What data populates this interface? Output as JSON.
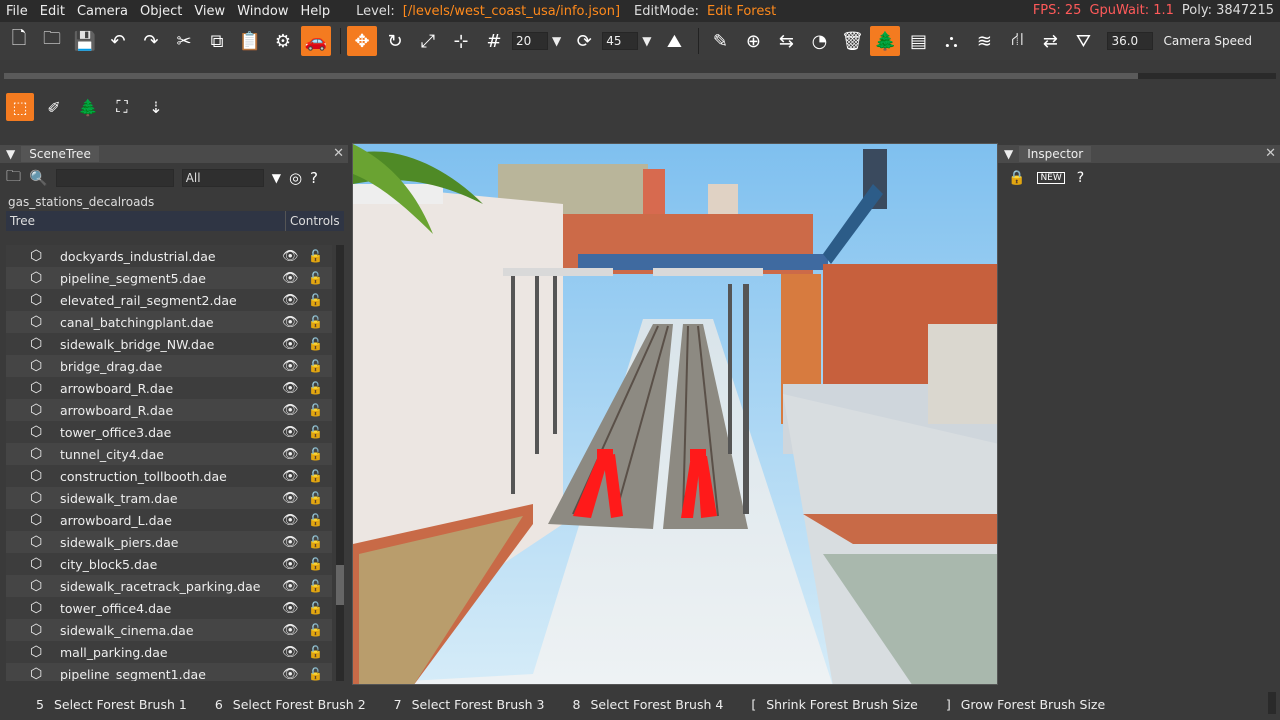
{
  "menu": {
    "items": [
      "File",
      "Edit",
      "Camera",
      "Object",
      "View",
      "Window",
      "Help"
    ],
    "level_label": "Level:",
    "level_value": "[/levels/west_coast_usa/info.json]",
    "editmode_label": "EditMode:",
    "editmode_value": "Edit Forest",
    "fps": "FPS: 25",
    "gpuwait": "GpuWait: 1.1",
    "poly": "Poly: 3847215"
  },
  "toolbar": {
    "snap_value": "20",
    "angle_value": "45",
    "camera_speed_value": "36.0",
    "camera_speed_label": "Camera Speed"
  },
  "scene_tree": {
    "title": "SceneTree",
    "filter_value": "All",
    "path": "gas_stations_decalroads",
    "col_tree": "Tree",
    "col_controls": "Controls",
    "rows": [
      "dockyards_industrial.dae",
      "pipeline_segment5.dae",
      "elevated_rail_segment2.dae",
      "canal_batchingplant.dae",
      "sidewalk_bridge_NW.dae",
      "bridge_drag.dae",
      "arrowboard_R.dae",
      "arrowboard_R.dae",
      "tower_office3.dae",
      "tunnel_city4.dae",
      "construction_tollbooth.dae",
      "sidewalk_tram.dae",
      "arrowboard_L.dae",
      "sidewalk_piers.dae",
      "city_block5.dae",
      "sidewalk_racetrack_parking.dae",
      "tower_office4.dae",
      "sidewalk_cinema.dae",
      "mall_parking.dae",
      "pipeline_segment1.dae"
    ]
  },
  "inspector": {
    "title": "Inspector",
    "new_badge": "NEW"
  },
  "status": {
    "hints": [
      {
        "key": "5",
        "label": "Select Forest Brush 1"
      },
      {
        "key": "6",
        "label": "Select Forest Brush 2"
      },
      {
        "key": "7",
        "label": "Select Forest Brush 3"
      },
      {
        "key": "8",
        "label": "Select Forest Brush 4"
      },
      {
        "key": "[",
        "label": "Shrink Forest Brush Size"
      },
      {
        "key": "]",
        "label": "Grow Forest Brush Size"
      }
    ]
  },
  "colors": {
    "accent": "#f47b20",
    "fps_red": "#ff5a5a",
    "level_orange": "#ff8a1c"
  }
}
